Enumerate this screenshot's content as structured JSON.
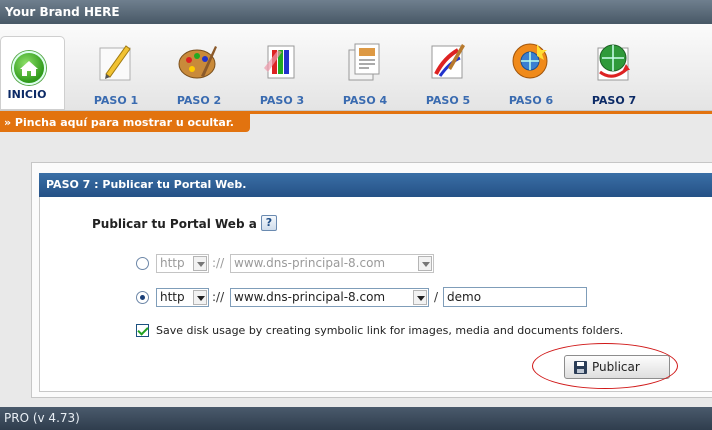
{
  "brand": "Your Brand HERE",
  "steps": [
    {
      "label": "INICIO",
      "icon": "home-icon"
    },
    {
      "label": "PASO 1",
      "icon": "pencil-icon"
    },
    {
      "label": "PASO 2",
      "icon": "palette-icon"
    },
    {
      "label": "PASO 3",
      "icon": "color-swatches-icon"
    },
    {
      "label": "PASO 4",
      "icon": "documents-icon"
    },
    {
      "label": "PASO 5",
      "icon": "brush-paint-icon"
    },
    {
      "label": "PASO 6",
      "icon": "globe-gear-icon"
    },
    {
      "label": "PASO 7",
      "icon": "globe-arrow-icon",
      "active": true
    }
  ],
  "toggle_text": "» Pincha aquí para mostrar u ocultar.",
  "panel": {
    "title": "PASO 7 : Publicar tu Portal Web.",
    "publish_label": "Publicar tu Portal Web a :",
    "help_glyph": "?",
    "option1": {
      "protocol": "http",
      "sep1": "://",
      "domain": "www.dns-principal-8.com",
      "selected": false
    },
    "option2": {
      "protocol": "http",
      "sep1": "://",
      "domain": "www.dns-principal-8.com",
      "sep2": "/",
      "folder": "demo",
      "selected": true
    },
    "checkbox_label": "Save disk usage by creating symbolic link for images, media and documents folders.",
    "checkbox_checked": true,
    "publish_button": "Publicar"
  },
  "footer": "PRO (v 4.73)",
  "colors": {
    "accent_orange": "#e2730f",
    "header_blue": "#2f5f96",
    "link_blue": "#3a6bb0",
    "active_navy": "#0c2a66"
  }
}
